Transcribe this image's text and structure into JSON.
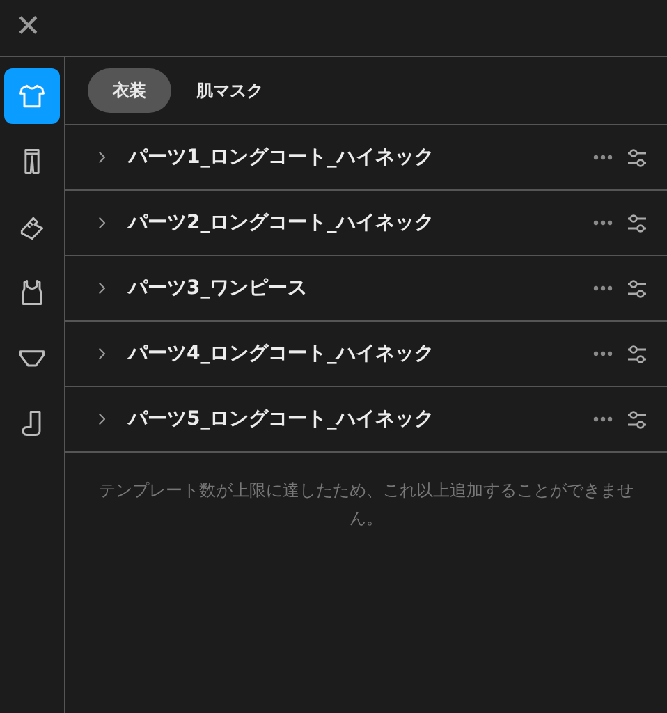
{
  "close_button": {
    "label": "✕"
  },
  "sidebar": {
    "items": [
      {
        "selected": true
      },
      {
        "selected": false
      },
      {
        "selected": false
      },
      {
        "selected": false
      },
      {
        "selected": false
      },
      {
        "selected": false
      }
    ]
  },
  "tabs": [
    {
      "label": "衣装",
      "selected": true
    },
    {
      "label": "肌マスク",
      "selected": false
    }
  ],
  "parts": [
    {
      "name": "パーツ1_ロングコート_ハイネック",
      "expanded": false
    },
    {
      "name": "パーツ2_ロングコート_ハイネック",
      "expanded": false
    },
    {
      "name": "パーツ3_ワンピース",
      "expanded": false
    },
    {
      "name": "パーツ4_ロングコート_ハイネック",
      "expanded": false
    },
    {
      "name": "パーツ5_ロングコート_ハイネック",
      "expanded": false
    }
  ],
  "notice": "テンプレート数が上限に達したため、これ以上追加することができません。"
}
